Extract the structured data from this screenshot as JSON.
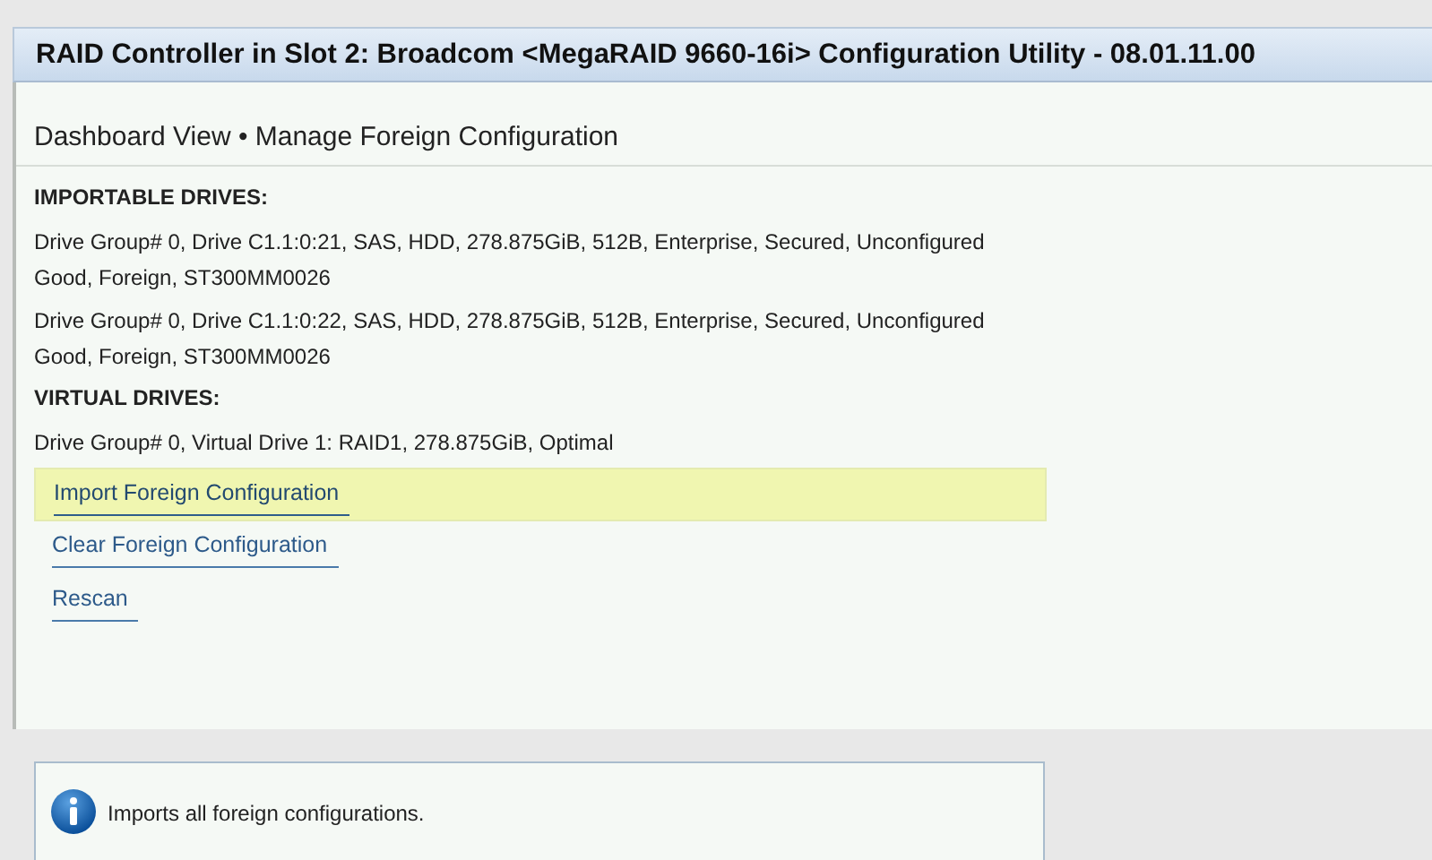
{
  "window": {
    "title": "RAID Controller in Slot 2: Broadcom <MegaRAID 9660-16i> Configuration Utility - 08.01.11.00"
  },
  "breadcrumb": "Dashboard View • Manage Foreign Configuration",
  "sections": [
    {
      "heading": "IMPORTABLE DRIVES:",
      "items": [
        "Drive Group# 0, Drive C1.1:0:21, SAS, HDD, 278.875GiB, 512B, Enterprise, Secured, Unconfigured Good, Foreign, ST300MM0026",
        "Drive Group# 0, Drive C1.1:0:22, SAS, HDD, 278.875GiB, 512B, Enterprise, Secured, Unconfigured Good, Foreign, ST300MM0026"
      ]
    },
    {
      "heading": "VIRTUAL DRIVES:",
      "items": [
        "Drive Group# 0, Virtual Drive 1: RAID1, 278.875GiB, Optimal"
      ]
    }
  ],
  "actions": [
    {
      "label": "Import Foreign Configuration",
      "selected": true
    },
    {
      "label": "Clear Foreign Configuration",
      "selected": false
    },
    {
      "label": "Rescan",
      "selected": false
    }
  ],
  "help": {
    "text": "Imports all foreign configurations."
  }
}
